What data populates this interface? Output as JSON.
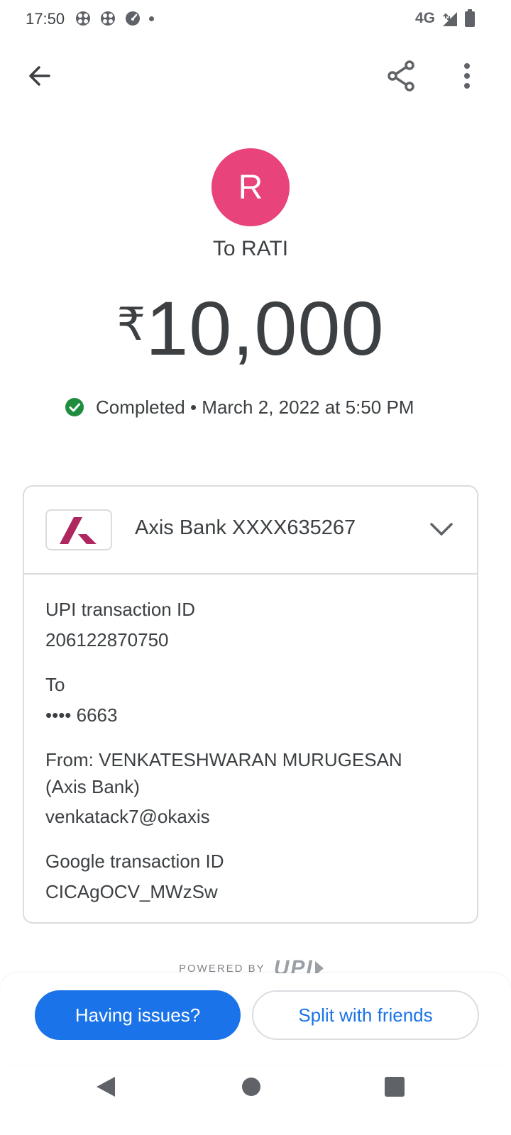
{
  "status_bar": {
    "time": "17:50",
    "network": "4G",
    "icons": [
      "fan-icon",
      "fan-icon",
      "speedometer-icon",
      "notification-dot-icon",
      "signal-icon",
      "battery-icon"
    ]
  },
  "top_bar": {
    "back_icon": "arrow-left-icon",
    "share_icon": "share-icon",
    "menu_icon": "more-vert-icon"
  },
  "recipient": {
    "initial": "R",
    "avatar_color": "#e8437a",
    "label": "To RATI"
  },
  "amount": {
    "currency": "₹",
    "value": "10,000"
  },
  "status": {
    "icon": "check-circle-icon",
    "color": "#1e8e3e",
    "text": "Completed • March 2, 2022 at 5:50 PM"
  },
  "account": {
    "bank_name": "Axis Bank XXXX635267",
    "logo_icon": "axis-bank-logo-icon",
    "logo_color": "#ae275f",
    "expand_icon": "chevron-down-icon"
  },
  "details": {
    "upi_id_label": "UPI transaction ID",
    "upi_id_value": "206122870750",
    "to_label": "To",
    "to_value": "•••• 6663",
    "from_label_line1": "From: VENKATESHWARAN MURUGESAN",
    "from_label_line2": "(Axis Bank)",
    "from_value": "venkatack7@okaxis",
    "google_id_label": "Google transaction ID",
    "google_id_value": "CICAgOCV_MWzSw"
  },
  "footer": {
    "powered_by": "POWERED BY",
    "upi_logo": "UPI"
  },
  "actions": {
    "issues_label": "Having issues?",
    "split_label": "Split with friends",
    "accent": "#1a73e8"
  },
  "nav": {
    "back": "nav-back-icon",
    "home": "nav-home-icon",
    "recents": "nav-recents-icon"
  }
}
